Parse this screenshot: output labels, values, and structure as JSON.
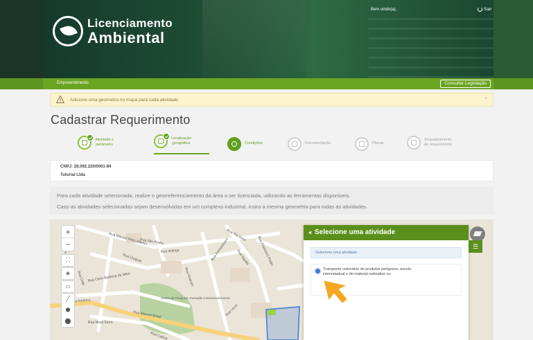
{
  "header": {
    "logo_line1": "Licenciamento",
    "logo_line2": "Ambiental",
    "welcome": "Bem vindo(a),",
    "exit_label": "Sair"
  },
  "navbar": {
    "breadcrumb": "Empreendimento",
    "legislation_button": "Consultar Legislação"
  },
  "alert": {
    "message": "Adicione uma geometria no mapa para cada atividade.",
    "close": "×"
  },
  "page": {
    "title": "Cadastrar Requerimento"
  },
  "steps": [
    {
      "label_l1": "Atividade e",
      "label_l2": "parâmetro",
      "state": "done"
    },
    {
      "label_l1": "Localização",
      "label_l2": "geográfica",
      "state": "active"
    },
    {
      "label_l1": "Condições",
      "label_l2": "",
      "state": "current"
    },
    {
      "label_l1": "Documentação",
      "label_l2": "",
      "state": "pending"
    },
    {
      "label_l1": "Placas",
      "label_l2": "",
      "state": "pending"
    },
    {
      "label_l1": "Enquadramento",
      "label_l2": "do requerimento",
      "state": "pending"
    }
  ],
  "company": {
    "cnpj": "CNPJ: 28.092.220/0001-84",
    "name": "Tutorial Ltda"
  },
  "info": {
    "line1": "Para cada atividade selecionada, realize o georreferenciamento da área a ser licenciada, utilizando as ferramentas disponíveis.",
    "line2": "Caso as atividades selecionadas sejam desenvolvidas em um complexo industrial, insira a mesma geometria para todas as atividades."
  },
  "map": {
    "zoom_in": "+",
    "zoom_out": "−",
    "streets": [
      "Rua Manoel Pinto Ribeiro",
      "Rua Ibitinga",
      "Rua Rio Doce",
      "Rua Uruguai",
      "Rua Chile",
      "Rua Pernambuco",
      "Rua Cleto Barbosa da Silva",
      "Rua Itajubá",
      "Rua Carlos Alberto",
      "Rua Guarani",
      "Rua Francisco Pedro",
      "Rua São Pedro",
      "Rua Américo",
      "Rua Manoel Brasil",
      "Rua Novo Ferro",
      "Rua Leoni",
      "Rua Cabral"
    ],
    "landmark": "Centro de Pesquisa, Inovação e Desenvolvimento",
    "panel": {
      "title": "Selecione uma atividade",
      "back": "◂",
      "subtitle": "Selecione uma atividade",
      "activity_l1": "Transporte rodoviário de produtos perigosos, exceto",
      "activity_l2": "interestadual e de material radioativo ou",
      "activity_l3": "..."
    }
  },
  "colors": {
    "brand_green": "#6aa521",
    "panel_green": "#5b8f1c",
    "alert_bg": "#fcf4cf",
    "polygon": "#3a7bd5"
  }
}
